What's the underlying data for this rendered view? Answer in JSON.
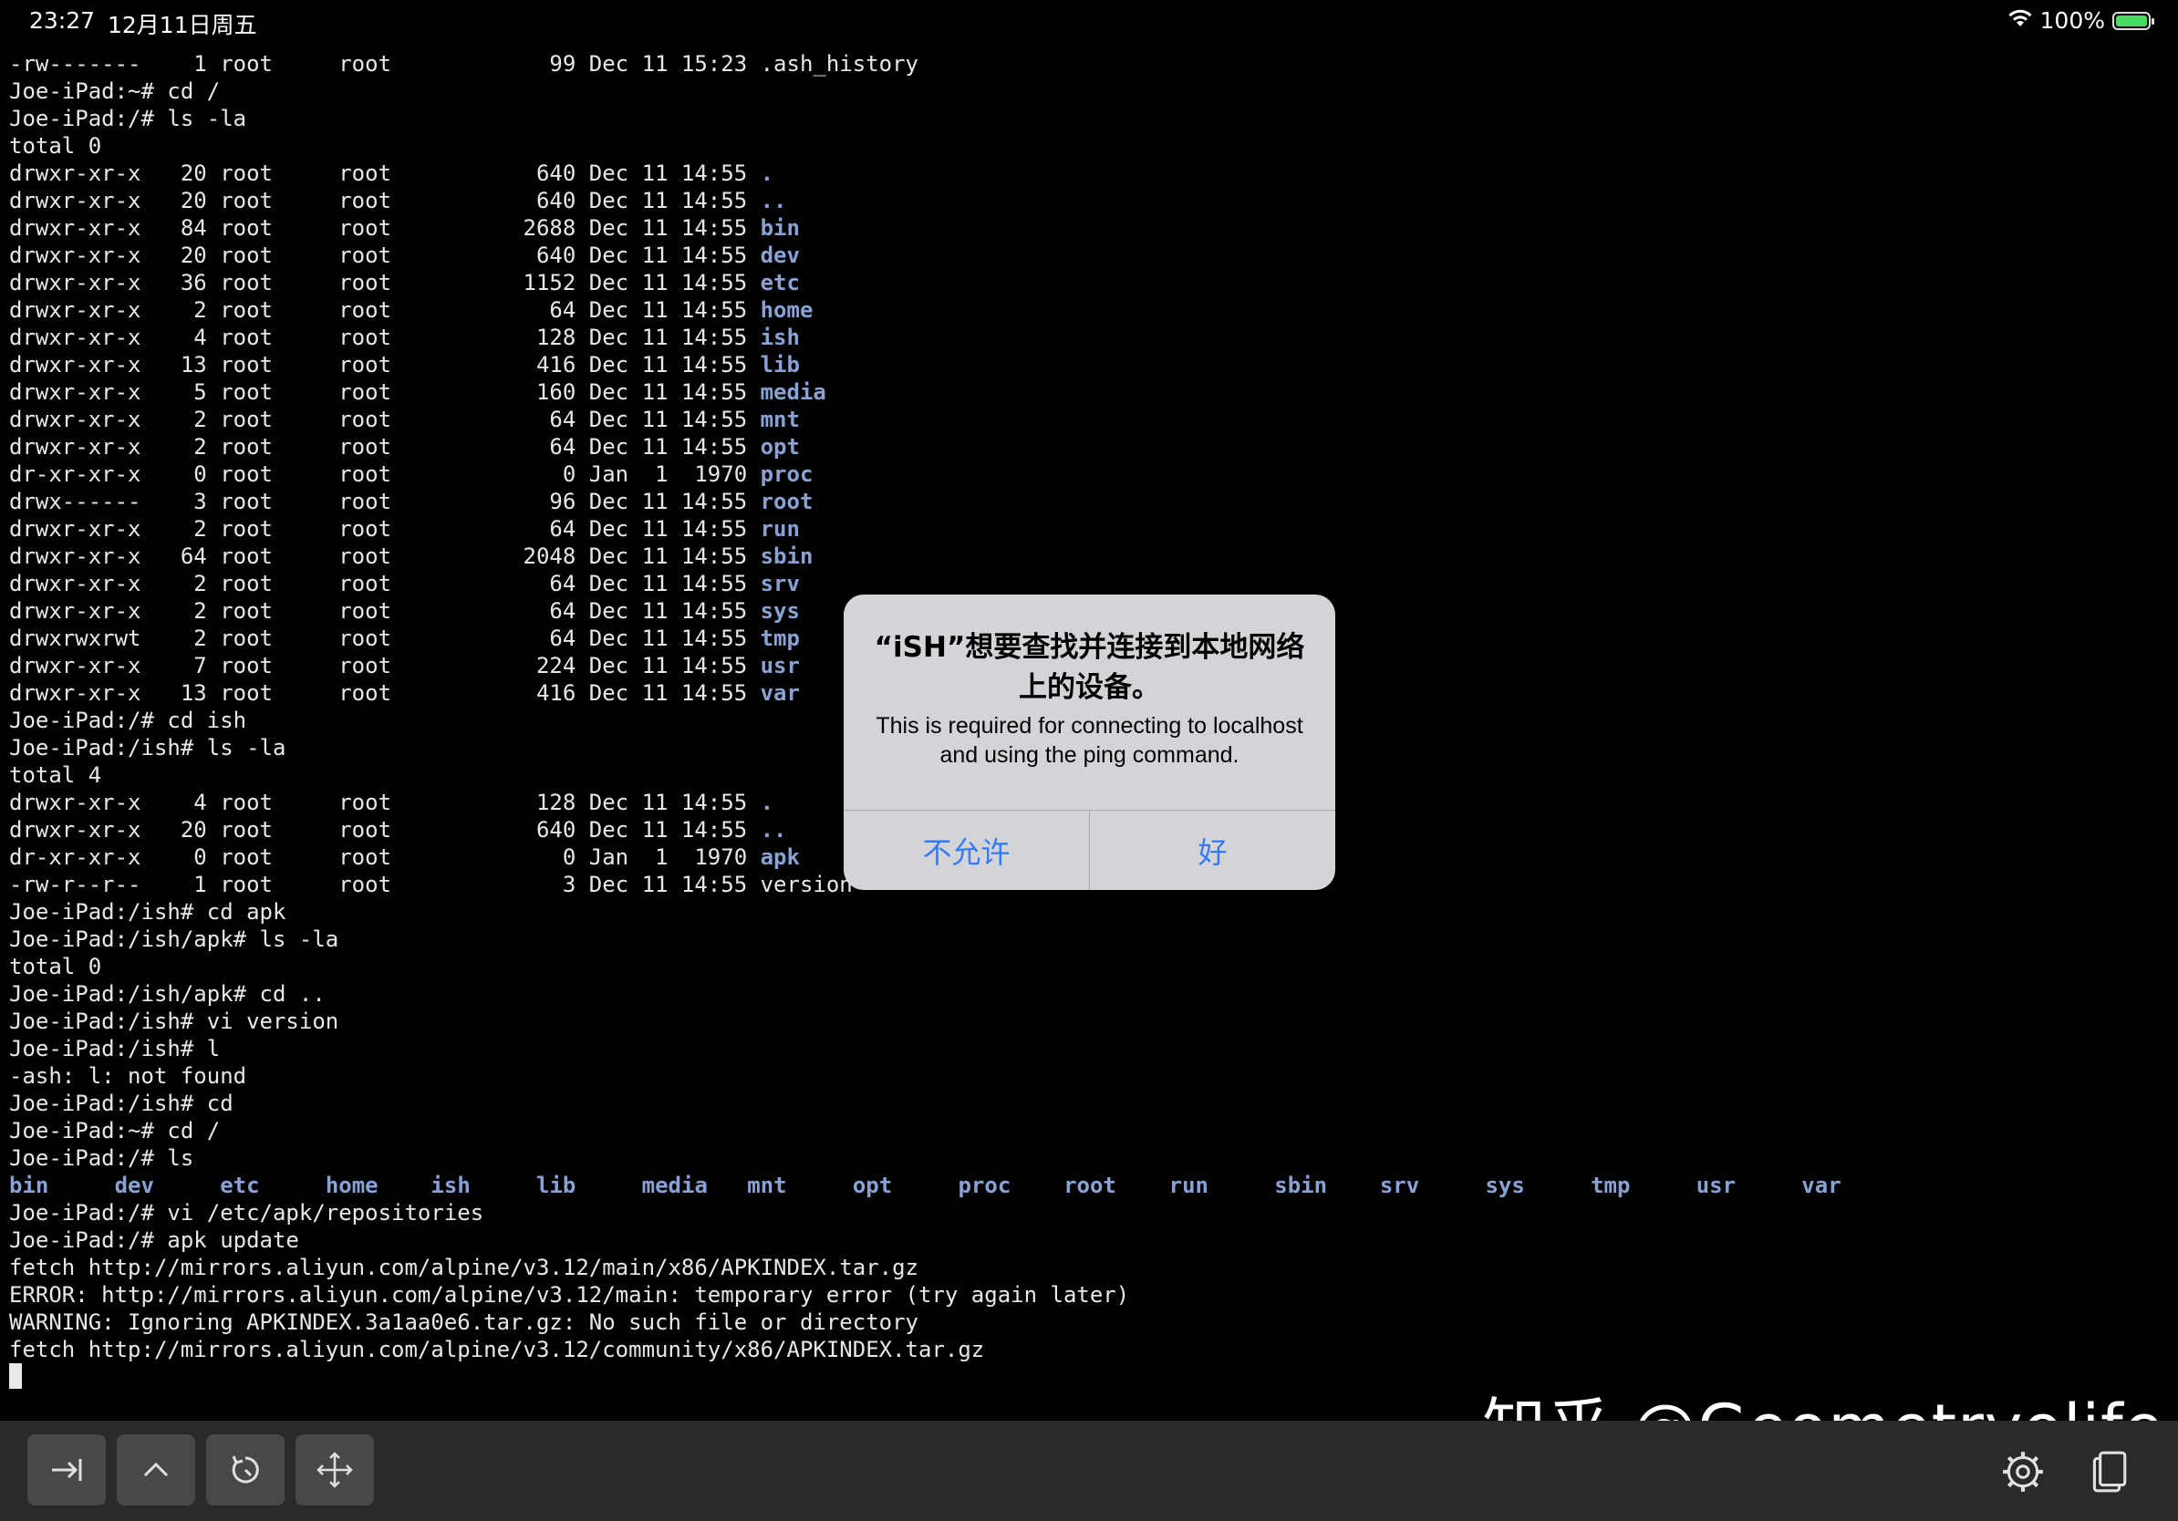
{
  "status_bar": {
    "time": "23:27",
    "date": "12月11日周五",
    "battery_text": "100%",
    "battery_level": 1.0
  },
  "terminal": {
    "lines": [
      [
        "-rw-------    1 root     root            99 Dec 11 15:23 .ash_history"
      ],
      [
        "Joe-iPad:~# cd /"
      ],
      [
        "Joe-iPad:/# ls -la"
      ],
      [
        "total 0"
      ],
      [
        "drwxr-xr-x   20 root     root           640 Dec 11 14:55 ",
        {
          "d": "."
        }
      ],
      [
        "drwxr-xr-x   20 root     root           640 Dec 11 14:55 ",
        {
          "d": ".."
        }
      ],
      [
        "drwxr-xr-x   84 root     root          2688 Dec 11 14:55 ",
        {
          "d": "bin"
        }
      ],
      [
        "drwxr-xr-x   20 root     root           640 Dec 11 14:55 ",
        {
          "d": "dev"
        }
      ],
      [
        "drwxr-xr-x   36 root     root          1152 Dec 11 14:55 ",
        {
          "d": "etc"
        }
      ],
      [
        "drwxr-xr-x    2 root     root            64 Dec 11 14:55 ",
        {
          "d": "home"
        }
      ],
      [
        "drwxr-xr-x    4 root     root           128 Dec 11 14:55 ",
        {
          "d": "ish"
        }
      ],
      [
        "drwxr-xr-x   13 root     root           416 Dec 11 14:55 ",
        {
          "d": "lib"
        }
      ],
      [
        "drwxr-xr-x    5 root     root           160 Dec 11 14:55 ",
        {
          "d": "media"
        }
      ],
      [
        "drwxr-xr-x    2 root     root            64 Dec 11 14:55 ",
        {
          "d": "mnt"
        }
      ],
      [
        "drwxr-xr-x    2 root     root            64 Dec 11 14:55 ",
        {
          "d": "opt"
        }
      ],
      [
        "dr-xr-xr-x    0 root     root             0 Jan  1  1970 ",
        {
          "d": "proc"
        }
      ],
      [
        "drwx------    3 root     root            96 Dec 11 14:55 ",
        {
          "d": "root"
        }
      ],
      [
        "drwxr-xr-x    2 root     root            64 Dec 11 14:55 ",
        {
          "d": "run"
        }
      ],
      [
        "drwxr-xr-x   64 root     root          2048 Dec 11 14:55 ",
        {
          "d": "sbin"
        }
      ],
      [
        "drwxr-xr-x    2 root     root            64 Dec 11 14:55 ",
        {
          "d": "srv"
        }
      ],
      [
        "drwxr-xr-x    2 root     root            64 Dec 11 14:55 ",
        {
          "d": "sys"
        }
      ],
      [
        "drwxrwxrwt    2 root     root            64 Dec 11 14:55 ",
        {
          "d": "tmp"
        }
      ],
      [
        "drwxr-xr-x    7 root     root           224 Dec 11 14:55 ",
        {
          "d": "usr"
        }
      ],
      [
        "drwxr-xr-x   13 root     root           416 Dec 11 14:55 ",
        {
          "d": "var"
        }
      ],
      [
        "Joe-iPad:/# cd ish"
      ],
      [
        "Joe-iPad:/ish# ls -la"
      ],
      [
        "total 4"
      ],
      [
        "drwxr-xr-x    4 root     root           128 Dec 11 14:55 ",
        {
          "d": "."
        }
      ],
      [
        "drwxr-xr-x   20 root     root           640 Dec 11 14:55 ",
        {
          "d": ".."
        }
      ],
      [
        "dr-xr-xr-x    0 root     root             0 Jan  1  1970 ",
        {
          "d": "apk"
        }
      ],
      [
        "-rw-r--r--    1 root     root             3 Dec 11 14:55 version"
      ],
      [
        "Joe-iPad:/ish# cd apk"
      ],
      [
        "Joe-iPad:/ish/apk# ls -la"
      ],
      [
        "total 0"
      ],
      [
        "Joe-iPad:/ish/apk# cd .."
      ],
      [
        "Joe-iPad:/ish# vi version"
      ],
      [
        "Joe-iPad:/ish# l"
      ],
      [
        "-ash: l: not found"
      ],
      [
        "Joe-iPad:/ish# cd"
      ],
      [
        "Joe-iPad:~# cd /"
      ],
      [
        "Joe-iPad:/# ls"
      ],
      [
        {
          "d": "bin"
        },
        "     ",
        {
          "d": "dev"
        },
        "     ",
        {
          "d": "etc"
        },
        "     ",
        {
          "d": "home"
        },
        "    ",
        {
          "d": "ish"
        },
        "     ",
        {
          "d": "lib"
        },
        "     ",
        {
          "d": "media"
        },
        "   ",
        {
          "d": "mnt"
        },
        "     ",
        {
          "d": "opt"
        },
        "     ",
        {
          "d": "proc"
        },
        "    ",
        {
          "d": "root"
        },
        "    ",
        {
          "d": "run"
        },
        "     ",
        {
          "d": "sbin"
        },
        "    ",
        {
          "d": "srv"
        },
        "     ",
        {
          "d": "sys"
        },
        "     ",
        {
          "d": "tmp"
        },
        "     ",
        {
          "d": "usr"
        },
        "     ",
        {
          "d": "var"
        }
      ],
      [
        "Joe-iPad:/# vi /etc/apk/repositories"
      ],
      [
        "Joe-iPad:/# apk update"
      ],
      [
        "fetch http://mirrors.aliyun.com/alpine/v3.12/main/x86/APKINDEX.tar.gz"
      ],
      [
        "ERROR: http://mirrors.aliyun.com/alpine/v3.12/main: temporary error (try again later)"
      ],
      [
        "WARNING: Ignoring APKINDEX.3a1aa0e6.tar.gz: No such file or directory"
      ],
      [
        "fetch http://mirrors.aliyun.com/alpine/v3.12/community/x86/APKINDEX.tar.gz"
      ]
    ]
  },
  "alert": {
    "title": "“iSH”想要查找并连接到本地网络上的设备。",
    "message": "This is required for connecting to localhost and using the ping command.",
    "deny_label": "不允许",
    "allow_label": "好",
    "button_color": "#2f7cf6"
  },
  "toolbar": {
    "buttons": [
      "tab-icon",
      "chevron-up-icon",
      "history-icon",
      "move-arrows-icon"
    ],
    "right_icons": [
      "gear-icon",
      "clipboard-icon"
    ]
  },
  "watermark": {
    "text": "知乎 @Geometryolife"
  },
  "colors": {
    "background": "#000000",
    "text": "#e8e8e8",
    "directory": "#8aa1d4",
    "toolbar": "#2a2a2c"
  }
}
